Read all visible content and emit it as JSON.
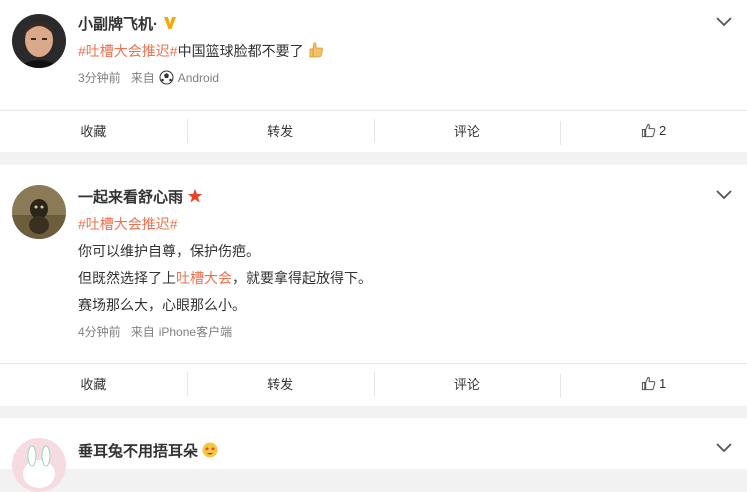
{
  "posts": [
    {
      "username": "小副牌飞机·",
      "badge": "V",
      "lines": [
        {
          "tag": "#吐槽大会推迟#",
          "text": "中国篮球脸都不要了"
        }
      ],
      "emoji_after": "thumbs-up-icon",
      "time": "3分钟前",
      "source_prefix": "来自",
      "source": "Android",
      "actions": {
        "favorite": "收藏",
        "repost": "转发",
        "comment": "评论",
        "likes": "2"
      }
    },
    {
      "username": "一起来看舒心雨",
      "badge": "star",
      "lines": [
        {
          "tag": "#吐槽大会推迟#",
          "text": ""
        },
        {
          "text": "你可以维护自尊，保护伤疤。"
        },
        {
          "pre": "但既然选择了上",
          "tag": "吐槽大会",
          "post": "，就要拿得起放得下。"
        },
        {
          "text": "赛场那么大，心眼那么小。"
        }
      ],
      "time": "4分钟前",
      "source_prefix": "来自",
      "source": "iPhone客户端",
      "actions": {
        "favorite": "收藏",
        "repost": "转发",
        "comment": "评论",
        "likes": "1"
      }
    },
    {
      "username": "垂耳兔不用捂耳朵",
      "emoji_after": "star-struck-face-icon"
    }
  ],
  "colors": {
    "tag": "#eb7350",
    "badge_v": "#f6a800",
    "star": "#e8432b",
    "meta": "#808080"
  }
}
